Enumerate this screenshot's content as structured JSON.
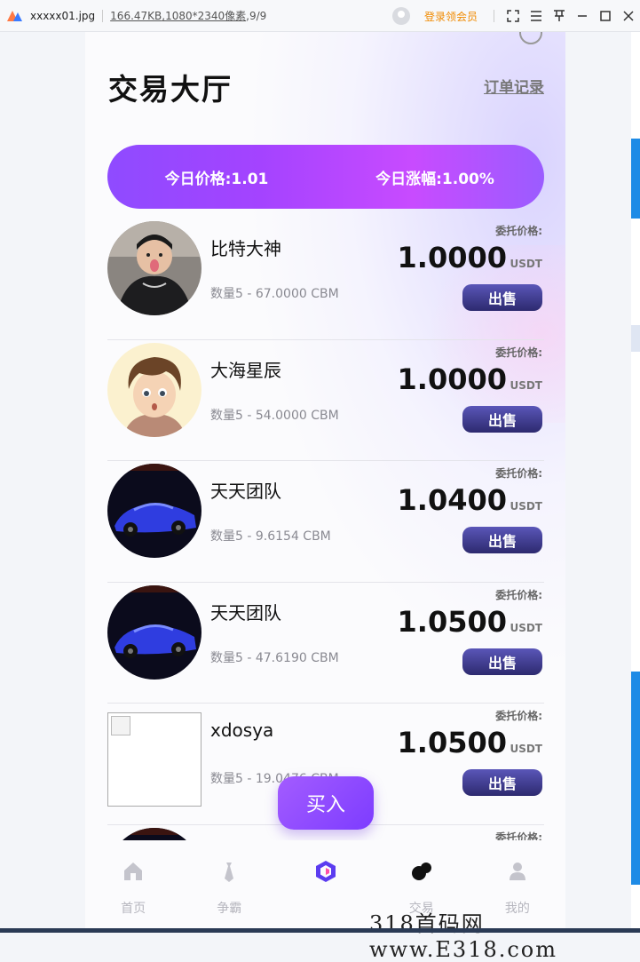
{
  "viewer": {
    "file_name": "xxxxx01.jpg",
    "file_size": "166.47KB",
    "dimensions": ",1080*2340像素",
    "page_counter": ",9/9",
    "login_label": "登录领会员"
  },
  "header": {
    "title": "交易大厅",
    "order_link": "订单记录"
  },
  "banner": {
    "price_label": "今日价格:1.01",
    "change_label": "今日涨幅:1.00%"
  },
  "trades": [
    {
      "name": "比特大神",
      "qty": "数量5 - 67.0000 CBM",
      "label": "委托价格:",
      "price": "1.0000",
      "unit": "USDT",
      "action": "出售",
      "avatar": "kid-photo"
    },
    {
      "name": "大海星辰",
      "qty": "数量5 - 54.0000 CBM",
      "label": "委托价格:",
      "price": "1.0000",
      "unit": "USDT",
      "action": "出售",
      "avatar": "cartoon-boy"
    },
    {
      "name": "天天团队",
      "qty": "数量5 - 9.6154 CBM",
      "label": "委托价格:",
      "price": "1.0400",
      "unit": "USDT",
      "action": "出售",
      "avatar": "blue-car"
    },
    {
      "name": "天天团队",
      "qty": "数量5 - 47.6190 CBM",
      "label": "委托价格:",
      "price": "1.0500",
      "unit": "USDT",
      "action": "出售",
      "avatar": "blue-car"
    },
    {
      "name": "xdosya",
      "qty": "数量5 - 19.0476 CBM",
      "label": "委托价格:",
      "price": "1.0500",
      "unit": "USDT",
      "action": "出售",
      "avatar": "broken-image"
    },
    {
      "name": "",
      "qty": "",
      "label": "委托价格:",
      "price": "",
      "unit": "",
      "action": "",
      "avatar": "blue-car"
    }
  ],
  "buy_button": "买入",
  "tabs": [
    {
      "label": "首页",
      "icon": "home-icon"
    },
    {
      "label": "争霸",
      "icon": "tie-icon"
    },
    {
      "label": "",
      "icon": "trade-logo-icon"
    },
    {
      "label": "交易",
      "icon": "dots-icon"
    },
    {
      "label": "我的",
      "icon": "user-icon"
    }
  ],
  "watermark": "318首码网 www.E318.com",
  "colors": {
    "accent": "#a443ff",
    "sell_button": "#2d2a6f",
    "tab_inactive": "#b6b6be"
  }
}
